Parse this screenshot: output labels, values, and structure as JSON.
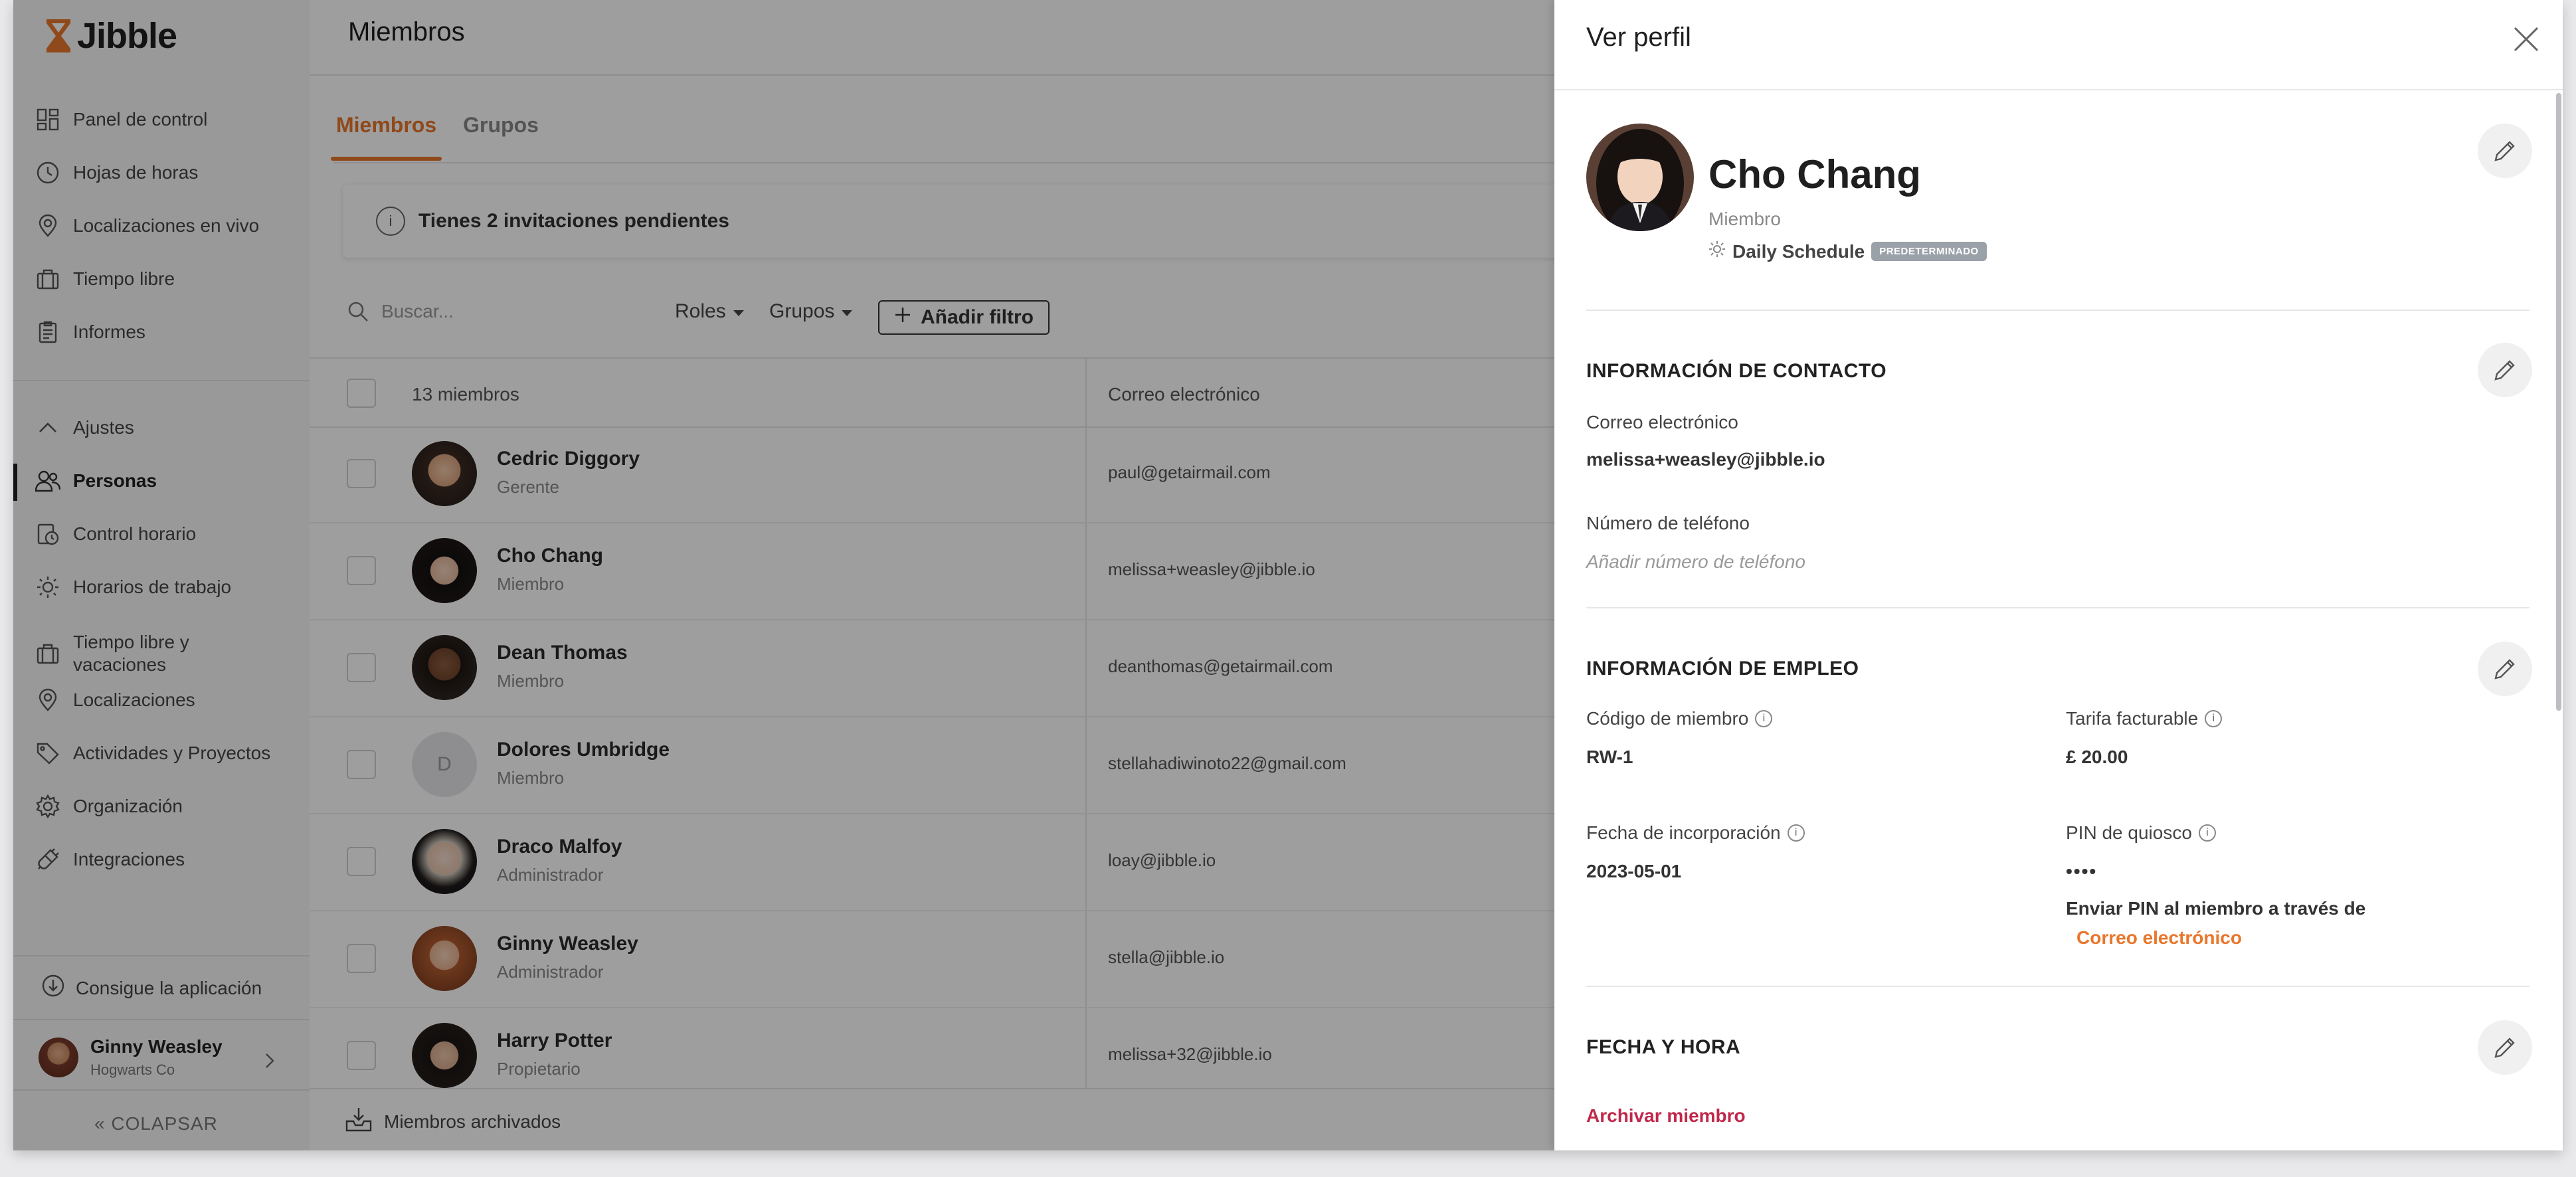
{
  "app": {
    "logo_text": "Jibble"
  },
  "sidebar": {
    "items": [
      {
        "label": "Panel de control",
        "icon": "dashboard-icon"
      },
      {
        "label": "Hojas de horas",
        "icon": "clock-icon"
      },
      {
        "label": "Localizaciones en vivo",
        "icon": "location-pin-icon"
      },
      {
        "label": "Tiempo libre",
        "icon": "suitcase-icon"
      },
      {
        "label": "Informes",
        "icon": "clipboard-icon"
      }
    ],
    "settings_label": "Ajustes",
    "settings_items": [
      {
        "label": "Personas",
        "icon": "people-icon",
        "active": true
      },
      {
        "label": "Control horario",
        "icon": "time-tracking-icon"
      },
      {
        "label": "Horarios de trabajo",
        "icon": "schedule-icon"
      },
      {
        "label": "Tiempo libre y vacaciones",
        "icon": "suitcase-icon"
      },
      {
        "label": "Localizaciones",
        "icon": "location-pin-icon"
      },
      {
        "label": "Actividades y Proyectos",
        "icon": "tag-icon"
      },
      {
        "label": "Organización",
        "icon": "gear-icon"
      },
      {
        "label": "Integraciones",
        "icon": "plug-icon"
      }
    ],
    "get_app_label": "Consigue la aplicación",
    "user": {
      "name": "Ginny Weasley",
      "company": "Hogwarts Co"
    },
    "collapse_label": "COLAPSAR"
  },
  "main": {
    "title": "Miembros",
    "tabs": [
      {
        "label": "Miembros",
        "active": true
      },
      {
        "label": "Grupos",
        "active": false
      }
    ],
    "alert_text": "Tienes 2 invitaciones pendientes",
    "search_placeholder": "Buscar...",
    "filters": {
      "roles": "Roles",
      "groups": "Grupos",
      "add_filter": "Añadir filtro"
    },
    "table": {
      "count_label": "13 miembros",
      "email_header": "Correo electrónico",
      "rows": [
        {
          "name": "Cedric Diggory",
          "role": "Gerente",
          "email": "paul@getairmail.com",
          "avatar": "photo"
        },
        {
          "name": "Cho Chang",
          "role": "Miembro",
          "email": "melissa+weasley@jibble.io",
          "avatar": "photo"
        },
        {
          "name": "Dean Thomas",
          "role": "Miembro",
          "email": "deanthomas@getairmail.com",
          "avatar": "photo"
        },
        {
          "name": "Dolores Umbridge",
          "role": "Miembro",
          "email": "stellahadiwinoto22@gmail.com",
          "avatar": "D"
        },
        {
          "name": "Draco Malfoy",
          "role": "Administrador",
          "email": "loay@jibble.io",
          "avatar": "photo"
        },
        {
          "name": "Ginny Weasley",
          "role": "Administrador",
          "email": "stella@jibble.io",
          "avatar": "photo"
        },
        {
          "name": "Harry Potter",
          "role": "Propietario",
          "email": "melissa+32@jibble.io",
          "avatar": "photo"
        }
      ]
    },
    "archived_label": "Miembros archivados"
  },
  "panel": {
    "title": "Ver perfil",
    "profile": {
      "name": "Cho Chang",
      "role": "Miembro",
      "schedule": "Daily Schedule",
      "schedule_badge": "PREDETERMINADO"
    },
    "contact": {
      "title": "INFORMACIÓN DE CONTACTO",
      "email_label": "Correo electrónico",
      "email_value": "melissa+weasley@jibble.io",
      "phone_label": "Número de teléfono",
      "phone_placeholder": "Añadir número de teléfono"
    },
    "employment": {
      "title": "INFORMACIÓN DE EMPLEO",
      "member_code_label": "Código de miembro",
      "member_code_value": "RW-1",
      "rate_label": "Tarifa facturable",
      "rate_value": "£ 20.00",
      "join_date_label": "Fecha de incorporación",
      "join_date_value": "2023-05-01",
      "kiosk_pin_label": "PIN de quiosco",
      "kiosk_pin_value": "••••",
      "send_pin_text": "Enviar PIN al miembro a través de",
      "send_pin_link": "Correo electrónico"
    },
    "datetime": {
      "title": "FECHA Y HORA"
    },
    "archive_link": "Archivar miembro"
  },
  "colors": {
    "accent": "#e9762b",
    "danger": "#c0284a",
    "badge": "#9aa1a8"
  }
}
